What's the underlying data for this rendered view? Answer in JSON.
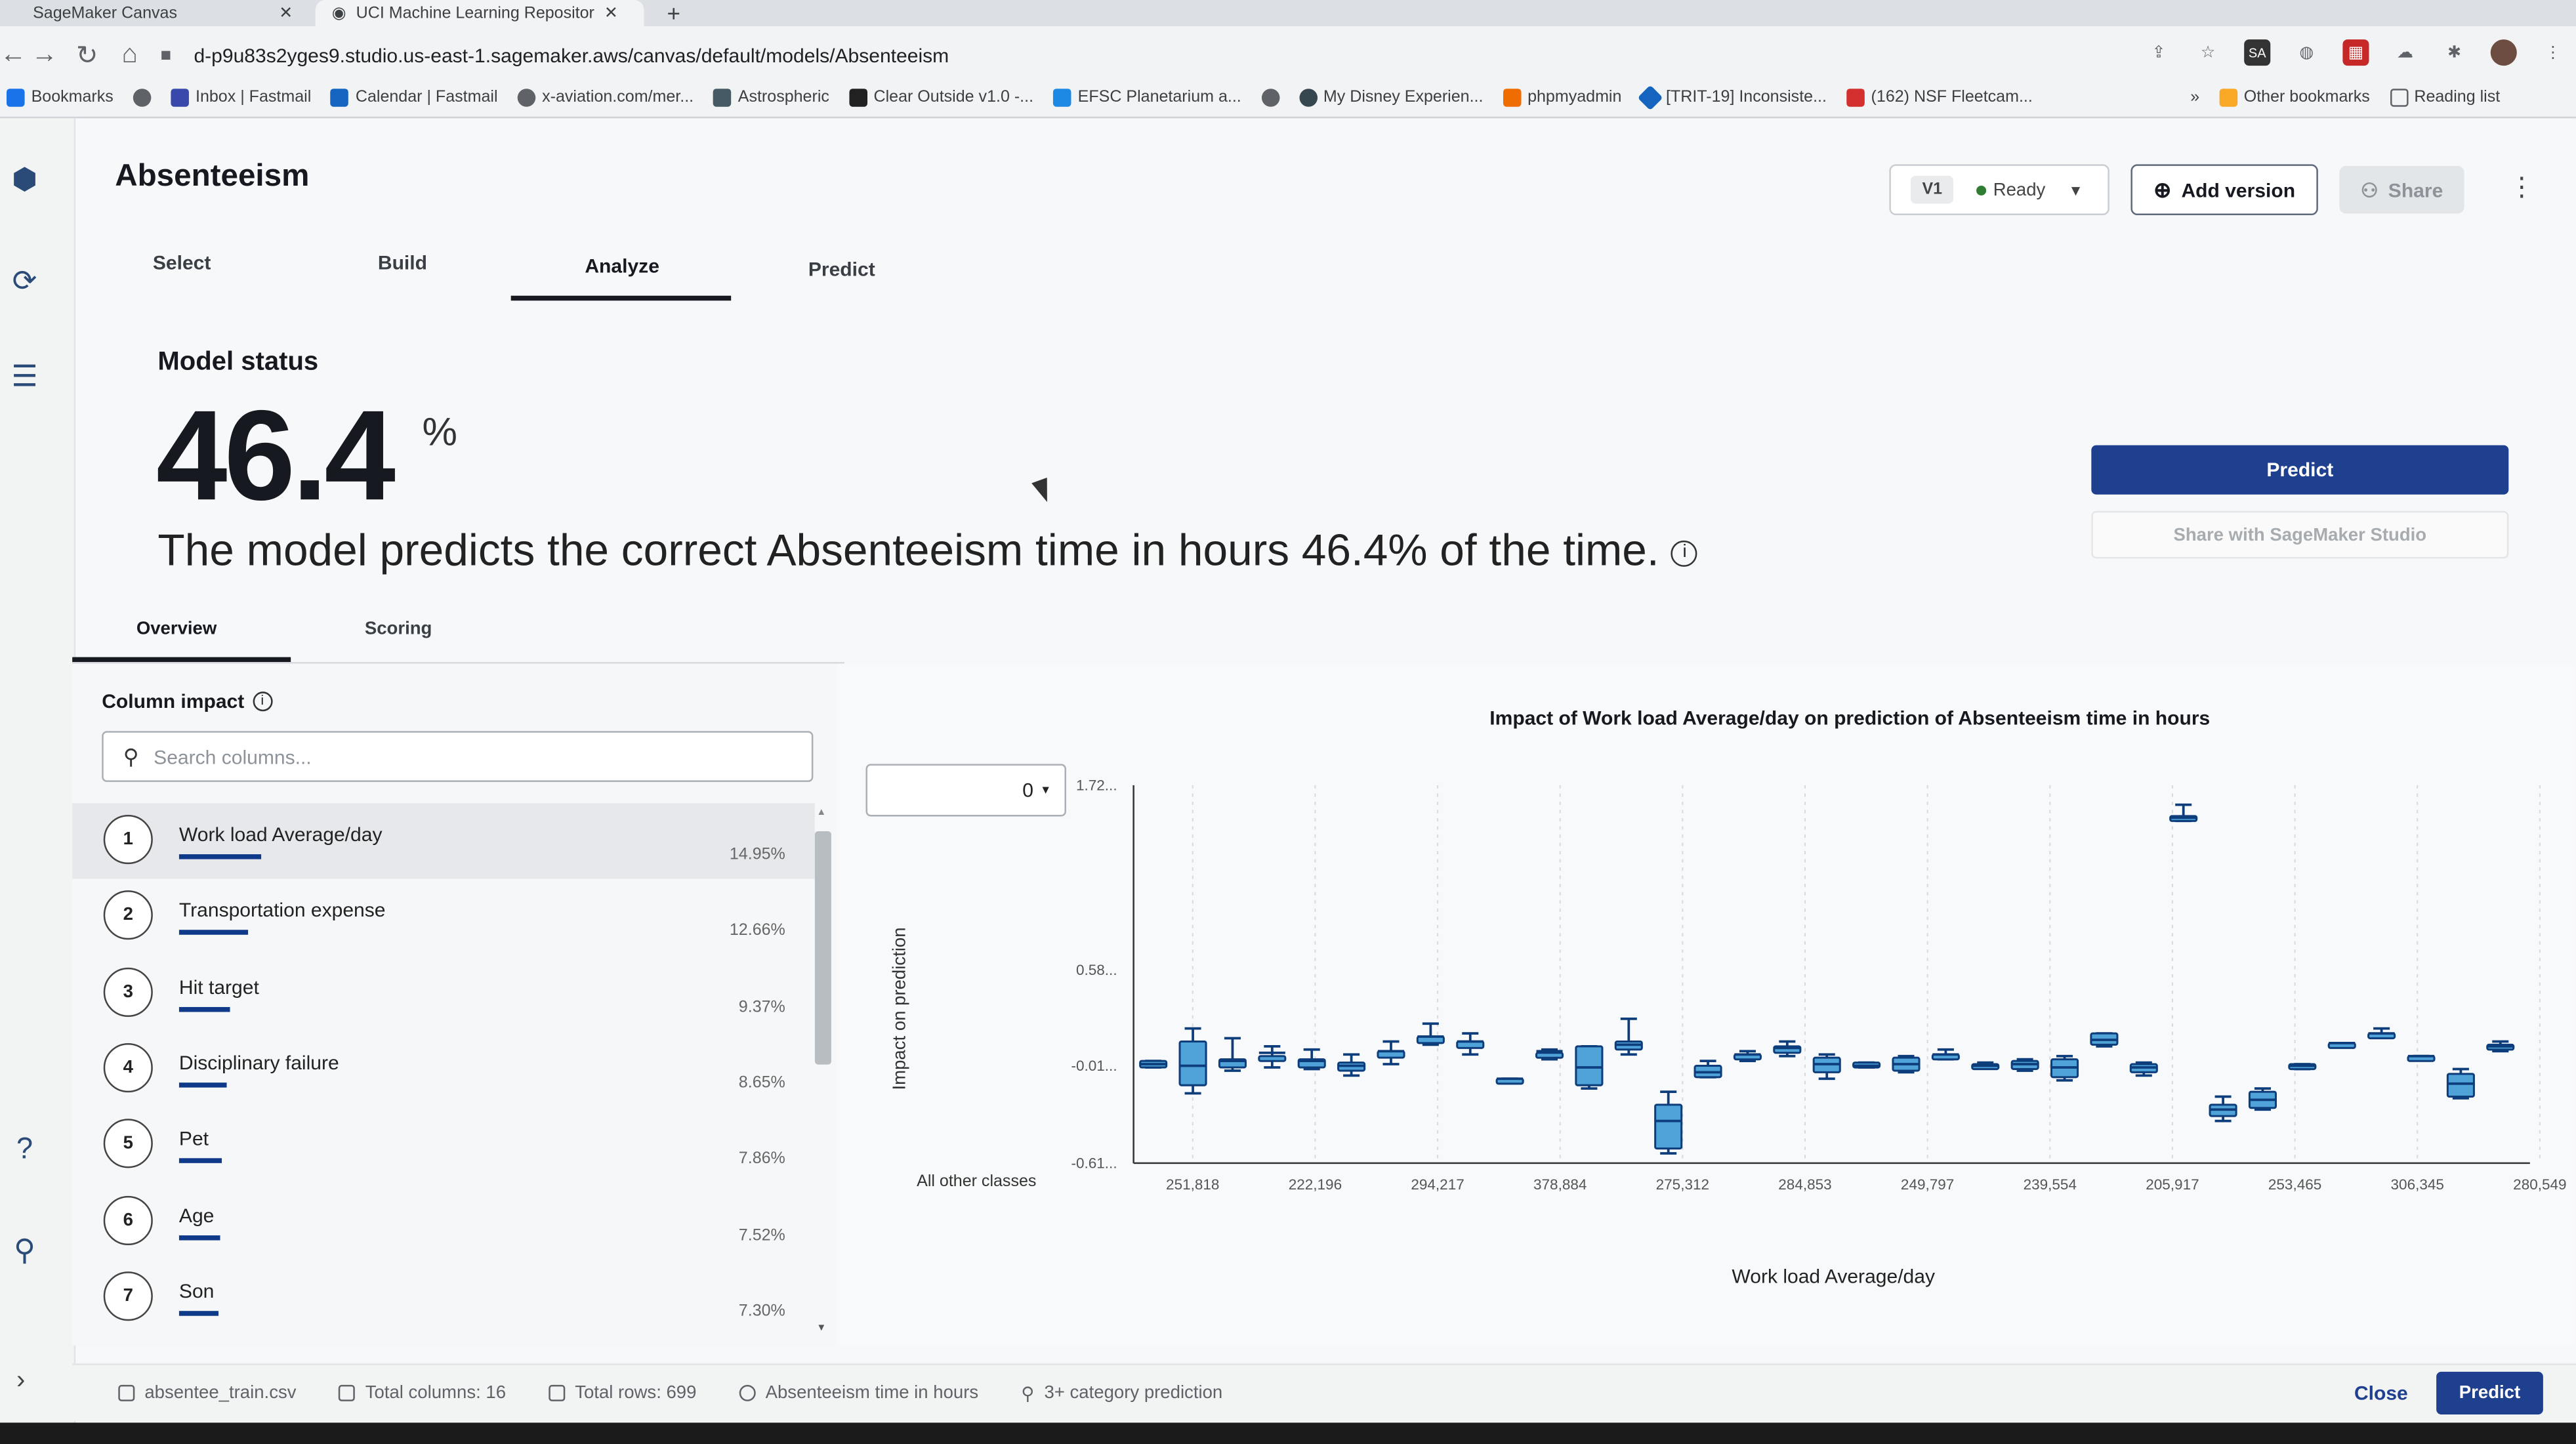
{
  "browser": {
    "tabs": [
      {
        "label": "SageMaker Canvas"
      },
      {
        "label": "UCI Machine Learning Repositor"
      }
    ],
    "url": "d-p9u83s2yges9.studio.us-east-1.sagemaker.aws/canvas/default/models/Absenteeism",
    "bookmarks": [
      "Bookmarks",
      "Inbox | Fastmail",
      "Calendar | Fastmail",
      "x-aviation.com/mer...",
      "Astrospheric",
      "Clear Outside v1.0 -...",
      "EFSC Planetarium a...",
      "My Disney Experien...",
      "phpmyadmin",
      "[TRIT-19] Inconsiste...",
      "(162) NSF Fleetcam..."
    ],
    "other_bookmarks": "Other bookmarks",
    "reading_list": "Reading list"
  },
  "app": {
    "title": "Absenteeism",
    "version_badge": "V1",
    "status": "Ready",
    "add_version": "Add version",
    "share": "Share"
  },
  "main_tabs": [
    {
      "label": "Select"
    },
    {
      "label": "Build"
    },
    {
      "label": "Analyze"
    },
    {
      "label": "Predict"
    }
  ],
  "model_status": {
    "heading": "Model status",
    "score": "46.4",
    "score_unit": "%",
    "description": "The model predicts the correct Absenteeism time in hours 46.4% of the time."
  },
  "actions": {
    "predict": "Predict",
    "share_studio": "Share with SageMaker Studio"
  },
  "sub_tabs": [
    {
      "label": "Overview"
    },
    {
      "label": "Scoring"
    }
  ],
  "column_impact": {
    "heading": "Column impact",
    "search_placeholder": "Search columns...",
    "items": [
      {
        "rank": "1",
        "name": "Work load Average/day",
        "value": "14.95%",
        "fraction": 0.1495
      },
      {
        "rank": "2",
        "name": "Transportation expense",
        "value": "12.66%",
        "fraction": 0.1266
      },
      {
        "rank": "3",
        "name": "Hit target",
        "value": "9.37%",
        "fraction": 0.0937
      },
      {
        "rank": "4",
        "name": "Disciplinary failure",
        "value": "8.65%",
        "fraction": 0.0865
      },
      {
        "rank": "5",
        "name": "Pet",
        "value": "7.86%",
        "fraction": 0.0786
      },
      {
        "rank": "6",
        "name": "Age",
        "value": "7.52%",
        "fraction": 0.0752
      },
      {
        "rank": "7",
        "name": "Son",
        "value": "7.30%",
        "fraction": 0.073
      }
    ]
  },
  "chart": {
    "class_select": "0",
    "y_label": "Impact on prediction",
    "other_classes_label": "All other classes"
  },
  "chart_data": {
    "type": "box",
    "title": "Impact of Work load Average/day on prediction of Absenteeism time in hours",
    "xlabel": "Work load Average/day",
    "ylabel": "Impact on prediction",
    "y_ticks": [
      "1.72...",
      "0.58...",
      "-0.01...",
      "-0.61..."
    ],
    "y_tick_values": [
      1.72,
      0.58,
      -0.01,
      -0.61
    ],
    "ylim": [
      -0.61,
      1.72
    ],
    "x_ticks": [
      "251,818",
      "222,196",
      "294,217",
      "378,884",
      "275,312",
      "284,853",
      "249,797",
      "239,554",
      "205,917",
      "253,465",
      "306,345",
      "280,549"
    ],
    "boxes": [
      {
        "mid": 0.0,
        "q1": -0.02,
        "q3": 0.02,
        "lo": -0.02,
        "hi": 0.02
      },
      {
        "mid": -0.01,
        "q1": -0.13,
        "q3": 0.14,
        "lo": -0.18,
        "hi": 0.22
      },
      {
        "mid": 0.02,
        "q1": -0.02,
        "q3": 0.03,
        "lo": -0.04,
        "hi": 0.16
      },
      {
        "mid": 0.07,
        "q1": 0.02,
        "q3": 0.05,
        "lo": -0.02,
        "hi": 0.11
      },
      {
        "mid": 0.02,
        "q1": -0.02,
        "q3": 0.03,
        "lo": -0.03,
        "hi": 0.09
      },
      {
        "mid": -0.01,
        "q1": -0.04,
        "q3": 0.01,
        "lo": -0.07,
        "hi": 0.06
      },
      {
        "mid": 0.08,
        "q1": 0.04,
        "q3": 0.08,
        "lo": 0.0,
        "hi": 0.14
      },
      {
        "mid": 0.17,
        "q1": 0.13,
        "q3": 0.17,
        "lo": 0.12,
        "hi": 0.25
      },
      {
        "mid": 0.14,
        "q1": 0.1,
        "q3": 0.14,
        "lo": 0.06,
        "hi": 0.19
      },
      {
        "mid": -0.09,
        "q1": -0.09,
        "q3": -0.09,
        "lo": -0.09,
        "hi": -0.09
      },
      {
        "mid": 0.08,
        "q1": 0.04,
        "q3": 0.07,
        "lo": 0.03,
        "hi": 0.09
      },
      {
        "mid": -0.02,
        "q1": -0.13,
        "q3": 0.11,
        "lo": -0.15,
        "hi": 0.11
      },
      {
        "mid": 0.12,
        "q1": 0.09,
        "q3": 0.14,
        "lo": 0.06,
        "hi": 0.28
      },
      {
        "mid": -0.35,
        "q1": -0.52,
        "q3": -0.25,
        "lo": -0.55,
        "hi": -0.17
      },
      {
        "mid": -0.05,
        "q1": -0.08,
        "q3": -0.01,
        "lo": -0.08,
        "hi": 0.02
      },
      {
        "mid": 0.06,
        "q1": 0.04,
        "q3": 0.06,
        "lo": 0.02,
        "hi": 0.08
      },
      {
        "mid": 0.1,
        "q1": 0.07,
        "q3": 0.11,
        "lo": 0.05,
        "hi": 0.14
      },
      {
        "mid": 0.0,
        "q1": -0.05,
        "q3": 0.04,
        "lo": -0.09,
        "hi": 0.06
      },
      {
        "mid": -0.01,
        "q1": -0.02,
        "q3": 0.01,
        "lo": -0.02,
        "hi": 0.01
      },
      {
        "mid": 0.0,
        "q1": -0.04,
        "q3": 0.04,
        "lo": -0.05,
        "hi": 0.05
      },
      {
        "mid": 0.06,
        "q1": 0.04,
        "q3": 0.06,
        "lo": 0.03,
        "hi": 0.09
      },
      {
        "mid": -0.01,
        "q1": -0.02,
        "q3": 0.0,
        "lo": -0.02,
        "hi": 0.01
      },
      {
        "mid": 0.0,
        "q1": -0.03,
        "q3": 0.02,
        "lo": -0.04,
        "hi": 0.03
      },
      {
        "mid": -0.02,
        "q1": -0.08,
        "q3": 0.03,
        "lo": -0.1,
        "hi": 0.05
      },
      {
        "mid": 0.15,
        "q1": 0.12,
        "q3": 0.19,
        "lo": 0.11,
        "hi": 0.19
      },
      {
        "mid": -0.02,
        "q1": -0.05,
        "q3": 0.0,
        "lo": -0.07,
        "hi": 0.01
      },
      {
        "mid": 1.52,
        "q1": 1.51,
        "q3": 1.53,
        "lo": 1.5,
        "hi": 1.6
      },
      {
        "mid": -0.28,
        "q1": -0.32,
        "q3": -0.25,
        "lo": -0.35,
        "hi": -0.2
      },
      {
        "mid": -0.22,
        "q1": -0.27,
        "q3": -0.17,
        "lo": -0.28,
        "hi": -0.15
      },
      {
        "mid": -0.01,
        "q1": -0.03,
        "q3": 0.0,
        "lo": -0.03,
        "hi": 0.0
      },
      {
        "mid": 0.13,
        "q1": 0.13,
        "q3": 0.13,
        "lo": 0.13,
        "hi": 0.13
      },
      {
        "mid": 0.19,
        "q1": 0.18,
        "q3": 0.19,
        "lo": 0.17,
        "hi": 0.22
      },
      {
        "mid": 0.05,
        "q1": 0.05,
        "q3": 0.05,
        "lo": 0.05,
        "hi": 0.05
      },
      {
        "mid": -0.12,
        "q1": -0.2,
        "q3": -0.06,
        "lo": -0.21,
        "hi": -0.03
      },
      {
        "mid": 0.11,
        "q1": 0.1,
        "q3": 0.12,
        "lo": 0.08,
        "hi": 0.14
      }
    ]
  },
  "footer": {
    "file": "absentee_train.csv",
    "total_columns": "Total columns: 16",
    "total_rows": "Total rows: 699",
    "target": "Absenteeism time in hours",
    "prediction_type": "3+ category prediction",
    "close": "Close",
    "predict": "Predict"
  }
}
